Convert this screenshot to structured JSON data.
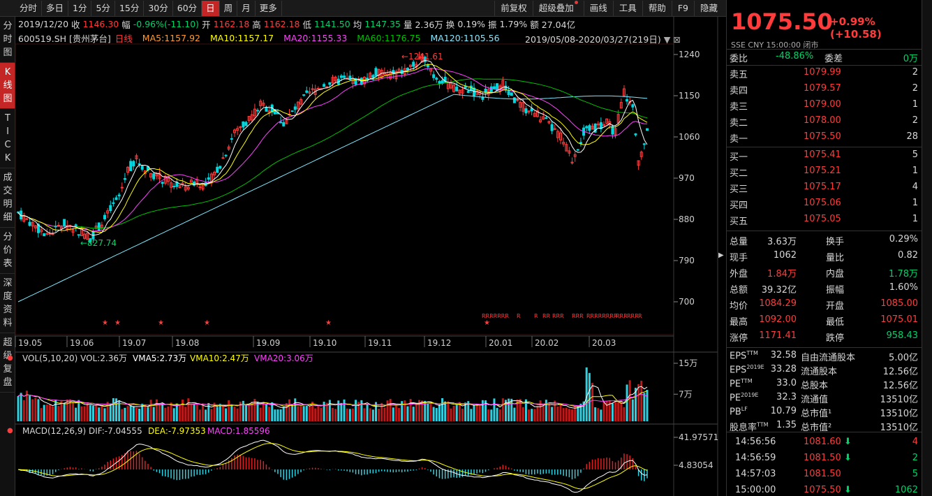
{
  "toolbar": {
    "left": [
      "分时",
      "多日",
      "1分",
      "5分",
      "15分",
      "30分",
      "60分",
      "日",
      "周",
      "月",
      "更多"
    ],
    "active": "日",
    "right": [
      "前复权",
      "超级叠加",
      "画线",
      "工具",
      "帮助",
      "F9",
      "隐藏"
    ]
  },
  "vtabs": [
    "分时图",
    "K线图",
    "TICK",
    "成交明细",
    "分价表",
    "深度资料",
    "超级复盘"
  ],
  "vtabs_active": "K线图",
  "info": {
    "date": "2019/12/20",
    "close_label": "收",
    "close": "1146.30",
    "amp_label": "幅",
    "amp": "-0.96%(-11.10)",
    "open_label": "开",
    "open": "1162.18",
    "high_label": "高",
    "high": "1162.18",
    "low_label": "低",
    "low": "1141.50",
    "avg_label": "均",
    "avg": "1147.35",
    "vol_label": "量",
    "vol": "2.36万",
    "turn_label": "换",
    "turn": "0.19%",
    "swing_label": "振",
    "swing": "1.79%",
    "amount_label": "额",
    "amount": "27.04亿"
  },
  "ma_line": {
    "symbol": "600519.SH [贵州茅台]",
    "type": "日线",
    "ma5": "MA5:1157.92",
    "ma10": "MA10:1157.17",
    "ma20": "MA20:1155.33",
    "ma60": "MA60:1176.75",
    "ma120": "MA120:1105.56",
    "range": "2019/05/08-2020/03/27(219日)"
  },
  "colors": {
    "up": "#ff3b3b",
    "down": "#00d8e0",
    "ma5": "#ffffff",
    "ma10": "#ffff00",
    "ma20": "#ff40ff",
    "ma60": "#00c000",
    "ma120": "#80e8ff"
  },
  "price_axis": [
    "1240",
    "1150",
    "1060",
    "970",
    "880",
    "790",
    "700"
  ],
  "annotations": {
    "high": "1241.61",
    "low": "827.74"
  },
  "time_axis": [
    "19.05",
    "19.06",
    "19.07",
    "19.08",
    "19.09",
    "19.10",
    "19.11",
    "19.12",
    "20.01",
    "20.02",
    "20.03"
  ],
  "vol_panel": {
    "title": "VOL(5,10,20) VOL:2.36万",
    "vma5": "VMA5:2.73万",
    "vma10": "VMA10:2.47万",
    "vma20": "VMA20:3.06万",
    "axis": [
      "15万",
      "7万"
    ]
  },
  "macd_panel": {
    "title": "MACD(12,26,9) DIF:-7.04555",
    "dea": "DEA:-7.97353",
    "macd": "MACD:1.85596",
    "axis": [
      "41.97571",
      "4.83054"
    ]
  },
  "quote": {
    "price": "1075.50",
    "change": "+0.99% (+10.58)",
    "sub": "SSE  CNY  15:00:00  闭市",
    "webi_label": "委比",
    "webi": "-48.86%",
    "weicha_label": "委差",
    "weicha": "0万",
    "asks": [
      {
        "label": "卖五",
        "price": "1079.99",
        "vol": "2"
      },
      {
        "label": "卖四",
        "price": "1079.57",
        "vol": "2"
      },
      {
        "label": "卖三",
        "price": "1079.00",
        "vol": "1"
      },
      {
        "label": "卖二",
        "price": "1078.00",
        "vol": "2"
      },
      {
        "label": "卖一",
        "price": "1075.50",
        "vol": "28"
      }
    ],
    "bids": [
      {
        "label": "买一",
        "price": "1075.41",
        "vol": "5"
      },
      {
        "label": "买二",
        "price": "1075.21",
        "vol": "1"
      },
      {
        "label": "买三",
        "price": "1075.17",
        "vol": "4"
      },
      {
        "label": "买四",
        "price": "1075.06",
        "vol": "1"
      },
      {
        "label": "买五",
        "price": "1075.05",
        "vol": "1"
      }
    ],
    "stats": [
      {
        "l1": "总量",
        "v1": "3.63万",
        "l2": "换手",
        "v2": "0.29%",
        "c1": "w",
        "c2": "w"
      },
      {
        "l1": "现手",
        "v1": "1062",
        "l2": "量比",
        "v2": "0.82",
        "c1": "w",
        "c2": "w"
      },
      {
        "l1": "外盘",
        "v1": "1.84万",
        "l2": "内盘",
        "v2": "1.78万",
        "c1": "r",
        "c2": "g"
      },
      {
        "l1": "总额",
        "v1": "39.32亿",
        "l2": "振幅",
        "v2": "1.60%",
        "c1": "w",
        "c2": "w"
      },
      {
        "l1": "均价",
        "v1": "1084.29",
        "l2": "开盘",
        "v2": "1085.00",
        "c1": "r",
        "c2": "r"
      },
      {
        "l1": "最高",
        "v1": "1092.00",
        "l2": "最低",
        "v2": "1075.01",
        "c1": "r",
        "c2": "r"
      },
      {
        "l1": "涨停",
        "v1": "1171.41",
        "l2": "跌停",
        "v2": "958.43",
        "c1": "r",
        "c2": "g"
      }
    ],
    "fund": [
      {
        "l1": "EPS",
        "s1": "TTM",
        "v1": "32.58",
        "l2": "自由流通股本",
        "v2": "5.00亿"
      },
      {
        "l1": "EPS",
        "s1": "2019E",
        "v1": "33.28",
        "l2": "流通股本",
        "v2": "12.56亿"
      },
      {
        "l1": "PE",
        "s1": "TTM",
        "v1": "33.0",
        "l2": "总股本",
        "v2": "12.56亿"
      },
      {
        "l1": "PE",
        "s1": "2019E",
        "v1": "32.3",
        "l2": "流通值",
        "v2": "13510亿"
      },
      {
        "l1": "PB",
        "s1": "LF",
        "v1": "10.79",
        "l2": "总市值¹",
        "v2": "13510亿"
      },
      {
        "l1": "股息率",
        "s1": "TTM",
        "v1": "1.35",
        "l2": "总市值²",
        "v2": "13510亿"
      }
    ],
    "ticks": [
      {
        "time": "14:56:56",
        "price": "1081.60",
        "dir": "down",
        "vol": "4",
        "vc": "r"
      },
      {
        "time": "14:56:59",
        "price": "1081.50",
        "dir": "down",
        "vol": "2",
        "vc": "g"
      },
      {
        "time": "14:57:03",
        "price": "1081.50",
        "dir": "",
        "vol": "5",
        "vc": "g"
      },
      {
        "time": "15:00:00",
        "price": "1075.50",
        "dir": "down",
        "vol": "1062",
        "vc": "g"
      }
    ]
  }
}
